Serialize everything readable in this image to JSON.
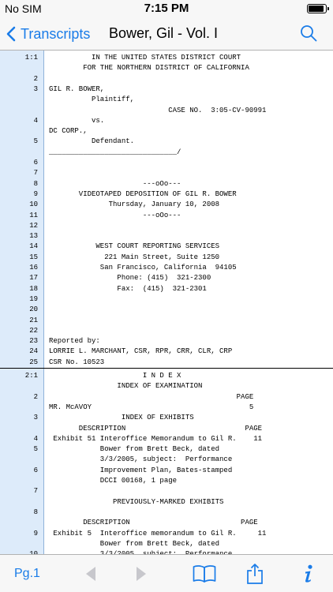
{
  "status": {
    "carrier": "No SIM",
    "time": "7:15 PM",
    "battery_level": 0.95
  },
  "nav": {
    "back_label": "Transcripts",
    "title": "Bower, Gil - Vol. I"
  },
  "toolbar": {
    "page_label": "Pg.1"
  },
  "colors": {
    "accent": "#1a7ce8",
    "gutter": "#ddebfa",
    "disabled": "#c7c7cc"
  },
  "icons": [
    "chevron-left-icon",
    "search-icon",
    "arrow-left-icon",
    "arrow-right-icon",
    "book-icon",
    "share-icon",
    "info-icon"
  ],
  "pages": [
    {
      "lines": [
        {
          "n": "1:1",
          "t": "          IN THE UNITED STATES DISTRICT COURT"
        },
        {
          "n": "",
          "t": "        FOR THE NORTHERN DISTRICT OF CALIFORNIA"
        },
        {
          "n": "2",
          "t": ""
        },
        {
          "n": "3",
          "t": "GIL R. BOWER,"
        },
        {
          "n": "",
          "t": "          Plaintiff,"
        },
        {
          "n": "",
          "t": "                            CASE NO.  3:05-CV-90991"
        },
        {
          "n": "4",
          "t": "          vs."
        },
        {
          "n": "",
          "t": "DC CORP.,"
        },
        {
          "n": "5",
          "t": "          Defendant."
        },
        {
          "n": "",
          "t": "______________________________/"
        },
        {
          "n": "6",
          "t": ""
        },
        {
          "n": "7",
          "t": ""
        },
        {
          "n": "8",
          "t": "                      ---oOo---"
        },
        {
          "n": "9",
          "t": "       VIDEOTAPED DEPOSITION OF GIL R. BOWER"
        },
        {
          "n": "10",
          "t": "              Thursday, January 10, 2008"
        },
        {
          "n": "11",
          "t": "                      ---oOo---"
        },
        {
          "n": "12",
          "t": ""
        },
        {
          "n": "13",
          "t": ""
        },
        {
          "n": "14",
          "t": "           WEST COURT REPORTING SERVICES"
        },
        {
          "n": "15",
          "t": "             221 Main Street, Suite 1250"
        },
        {
          "n": "16",
          "t": "            San Francisco, California  94105"
        },
        {
          "n": "17",
          "t": "                Phone: (415)  321-2300"
        },
        {
          "n": "18",
          "t": "                Fax:  (415)  321-2301"
        },
        {
          "n": "19",
          "t": ""
        },
        {
          "n": "20",
          "t": ""
        },
        {
          "n": "21",
          "t": ""
        },
        {
          "n": "22",
          "t": ""
        },
        {
          "n": "23",
          "t": "Reported by:"
        },
        {
          "n": "24",
          "t": "LORRIE L. MARCHANT, CSR, RPR, CRR, CLR, CRP"
        },
        {
          "n": "25",
          "t": "CSR No. 10523"
        }
      ]
    },
    {
      "lines": [
        {
          "n": "2:1",
          "t": "                      I N D E X"
        },
        {
          "n": "",
          "t": "                INDEX OF EXAMINATION"
        },
        {
          "n": "2",
          "t": "                                            PAGE"
        },
        {
          "n": "",
          "t": "MR. McAVOY                                     5"
        },
        {
          "n": "3",
          "t": "                 INDEX OF EXHIBITS"
        },
        {
          "n": "",
          "t": "       DESCRIPTION                            PAGE"
        },
        {
          "n": "4",
          "t": " Exhibit 51 Interoffice Memorandum to Gil R.    11"
        },
        {
          "n": "5",
          "t": "            Bower from Brett Beck, dated"
        },
        {
          "n": "",
          "t": "            3/3/2005, subject:  Performance"
        },
        {
          "n": "6",
          "t": "            Improvement Plan, Bates-stamped"
        },
        {
          "n": "",
          "t": "            DCCI 00168, 1 page"
        },
        {
          "n": "7",
          "t": ""
        },
        {
          "n": "",
          "t": "               PREVIOUSLY-MARKED EXHIBITS"
        },
        {
          "n": "8",
          "t": ""
        },
        {
          "n": "",
          "t": "        DESCRIPTION                          PAGE"
        },
        {
          "n": "9",
          "t": " Exhibit 5  Interoffice memorandum to Gil R.     11"
        },
        {
          "n": "",
          "t": "            Bower from Brett Beck, dated"
        },
        {
          "n": "10",
          "t": "            3/3/2005, subject:  Performance"
        }
      ]
    }
  ]
}
